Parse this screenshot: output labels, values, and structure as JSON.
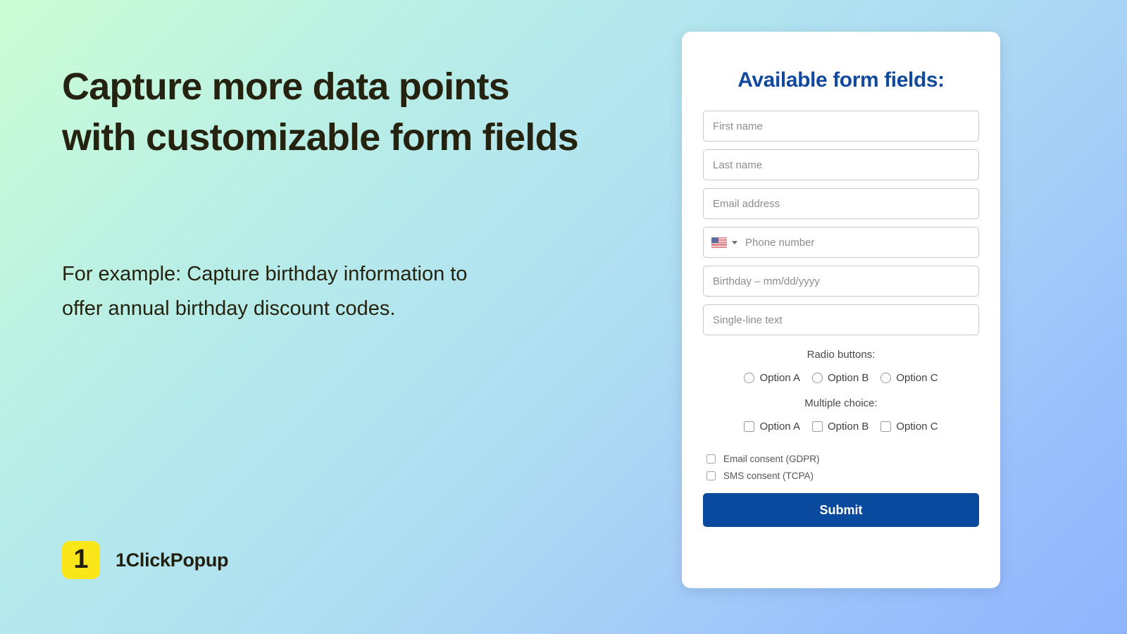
{
  "hero": {
    "headline": "Capture more data points with customizable form fields",
    "subtext": "For example: Capture birthday information to offer annual birthday discount codes."
  },
  "logo": {
    "mark": "1",
    "name": "1ClickPopup"
  },
  "form": {
    "title": "Available form fields:",
    "fields": [
      {
        "placeholder": "First name"
      },
      {
        "placeholder": "Last name"
      },
      {
        "placeholder": "Email address"
      },
      {
        "placeholder": "Phone number"
      },
      {
        "placeholder": "Birthday – mm/dd/yyyy"
      },
      {
        "placeholder": "Single-line text"
      }
    ],
    "phone_country": "US",
    "radio_group": {
      "label": "Radio buttons:",
      "options": [
        "Option A",
        "Option B",
        "Option C"
      ]
    },
    "checkbox_group": {
      "label": "Multiple choice:",
      "options": [
        "Option A",
        "Option B",
        "Option C"
      ]
    },
    "consents": [
      "Email consent (GDPR)",
      "SMS consent (TCPA)"
    ],
    "submit_label": "Submit"
  },
  "colors": {
    "heading_blue": "#12499d",
    "submit_blue": "#0a4a9e",
    "logo_yellow": "#fbe619",
    "text_dark": "#25230f",
    "gradient_start": "#cdfdd4",
    "gradient_end": "#8fb4fd"
  }
}
